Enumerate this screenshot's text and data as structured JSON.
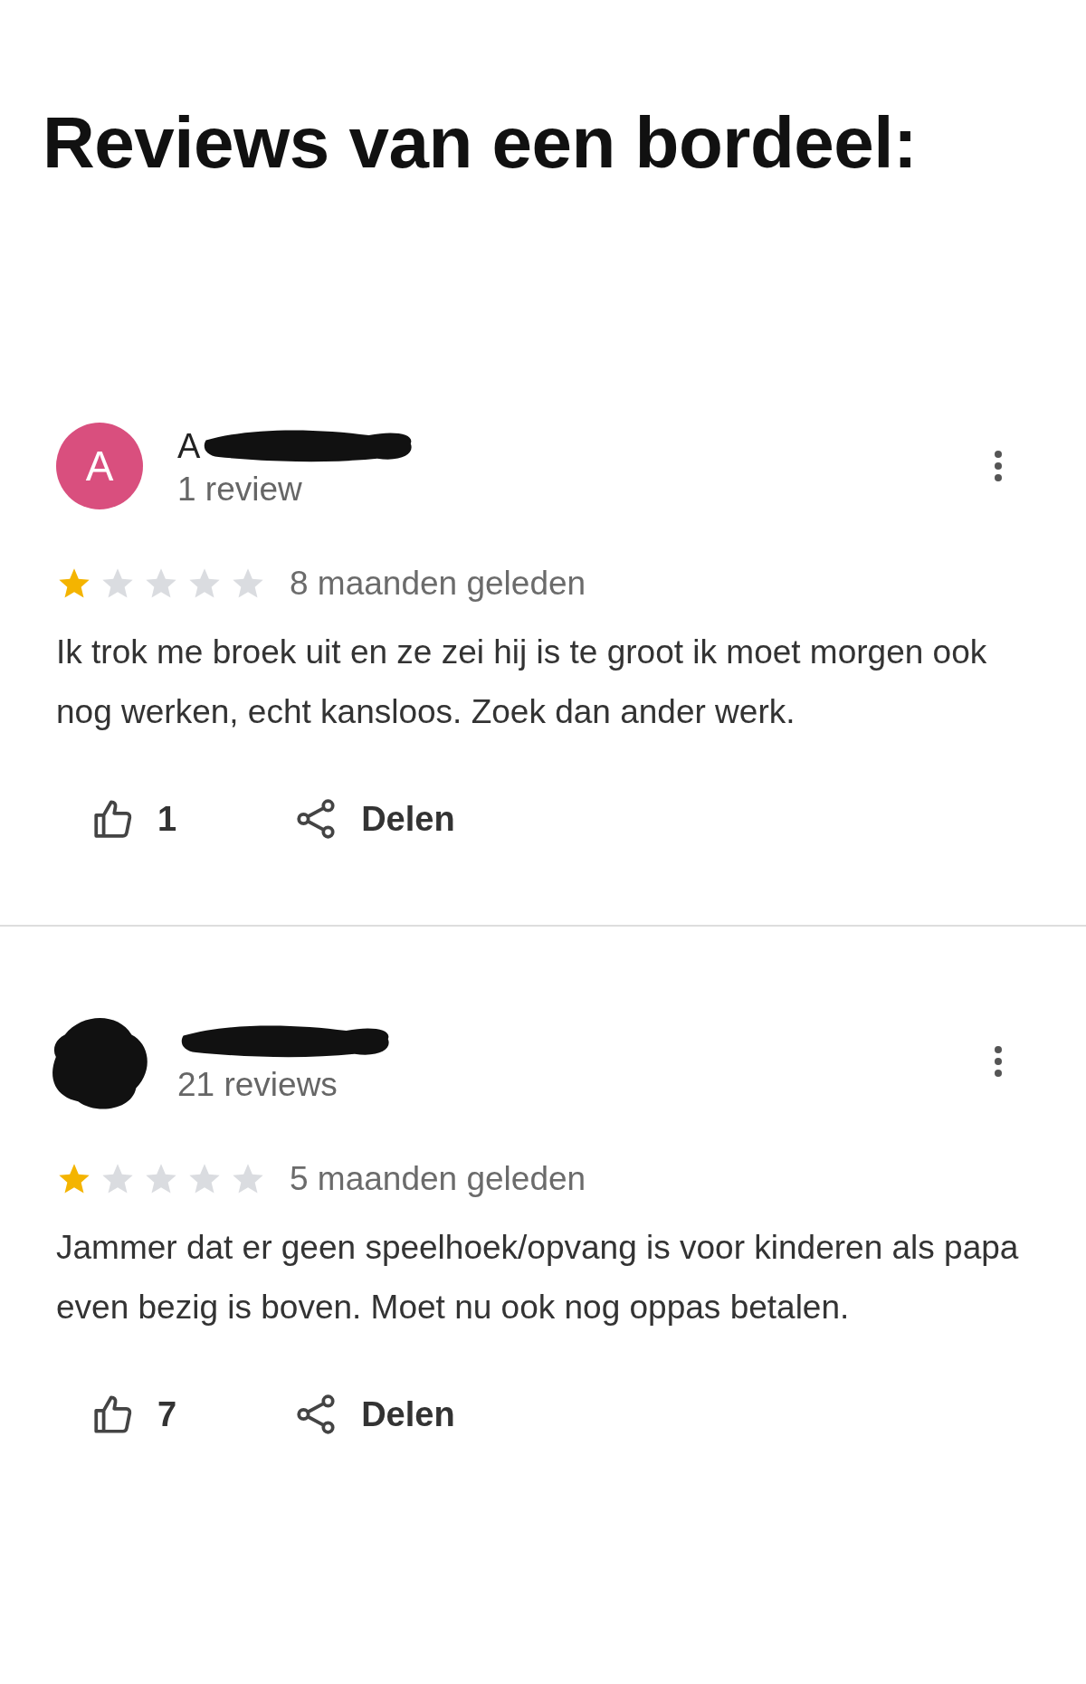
{
  "title": "Reviews van een bordeel:",
  "reviews": [
    {
      "avatar": {
        "kind": "letter",
        "letter": "A"
      },
      "name": "A",
      "review_count": "1 review",
      "stars": 1,
      "time": "8 maanden geleden",
      "text": "Ik trok me broek uit en ze zei hij is te groot ik moet morgen ook nog werken, echt kansloos. Zoek dan ander werk.",
      "likes": "1",
      "share": "Delen"
    },
    {
      "avatar": {
        "kind": "redacted"
      },
      "review_count": "21 reviews",
      "stars": 1,
      "time": "5 maanden geleden",
      "text": "Jammer dat er geen speelhoek/opvang is voor kinderen als papa even bezig is boven. Moet nu ook nog oppas betalen.",
      "likes": "7",
      "share": "Delen"
    }
  ]
}
